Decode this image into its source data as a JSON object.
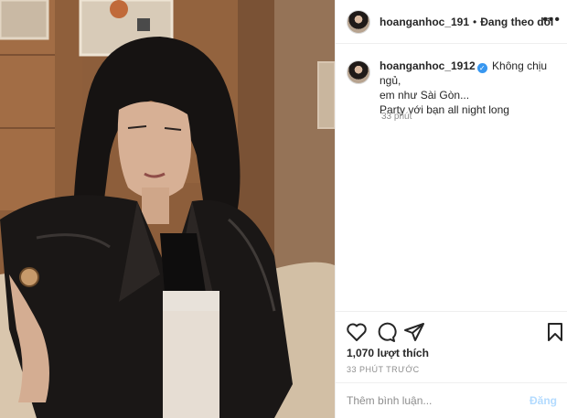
{
  "post": {
    "image_description": "photo"
  },
  "header": {
    "username": "hoanganhoc_191",
    "separator": "•",
    "follow_status": "Đang theo dõi",
    "more_icon": "more-horizontal-icon"
  },
  "caption": {
    "username": "hoanganhoc_1912",
    "verified_icon": "verified-badge-icon",
    "line1": "Không chịu ngủ,",
    "line2": "em như Sài Gòn...",
    "line3": "Party với bạn all night long",
    "time": "33 phút"
  },
  "actions": {
    "like_icon": "heart-icon",
    "comment_icon": "comment-icon",
    "share_icon": "share-icon",
    "save_icon": "bookmark-icon"
  },
  "likes": "1,070 lượt thích",
  "posted_ago": "33 PHÚT TRƯỚC",
  "comment": {
    "placeholder": "Thêm bình luận...",
    "post_label": "Đăng"
  },
  "colors": {
    "link_blue": "#3897f0",
    "post_button_disabled": "#b3dbff",
    "muted_text": "#8e8e8e"
  }
}
